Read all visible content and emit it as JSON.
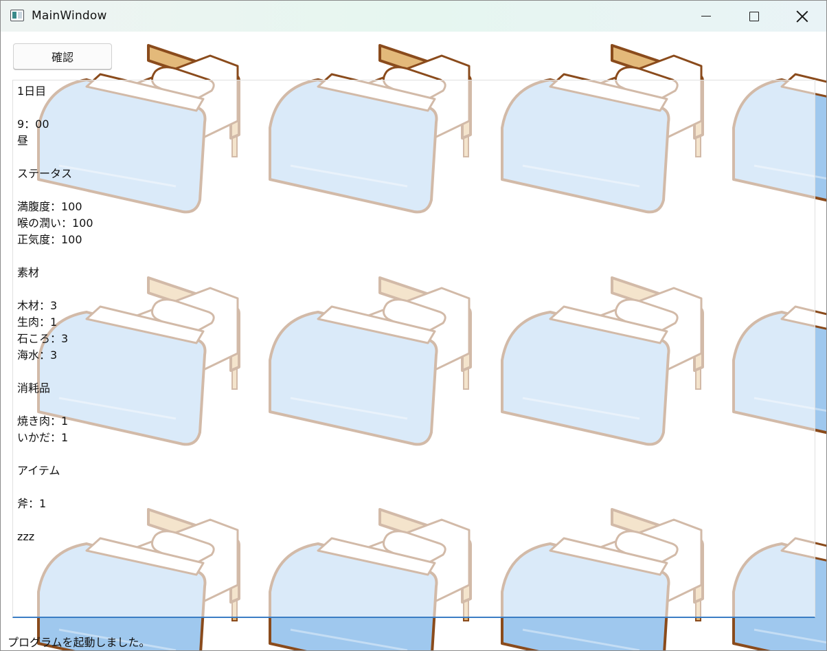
{
  "window": {
    "title": "MainWindow",
    "icon": "window-app-icon",
    "controls": [
      "minimize-icon",
      "maximize-icon",
      "close-icon"
    ]
  },
  "toolbar": {
    "confirm_label": "確認"
  },
  "log": {
    "lines": [
      "1日目",
      "",
      "9：00",
      "昼",
      "",
      "ステータス",
      "",
      "満腹度：100",
      "喉の潤い：100",
      "正気度：100",
      "",
      "素材",
      "",
      "木材：3",
      "生肉：1",
      "石ころ：3",
      "海水：3",
      "",
      "消耗品",
      "",
      "焼き肉：1",
      "いかだ：1",
      "",
      "アイテム",
      "",
      "斧：1",
      "",
      "zzz"
    ]
  },
  "status": {
    "message": "プログラムを起動しました。"
  },
  "background": {
    "pattern": "bed-illustration",
    "colors": {
      "frame": "#e3b97a",
      "outline": "#8a4b1c",
      "blanket": "#9fc8ee",
      "pillow": "#ffffff",
      "accent": "#3a7dc4"
    }
  }
}
